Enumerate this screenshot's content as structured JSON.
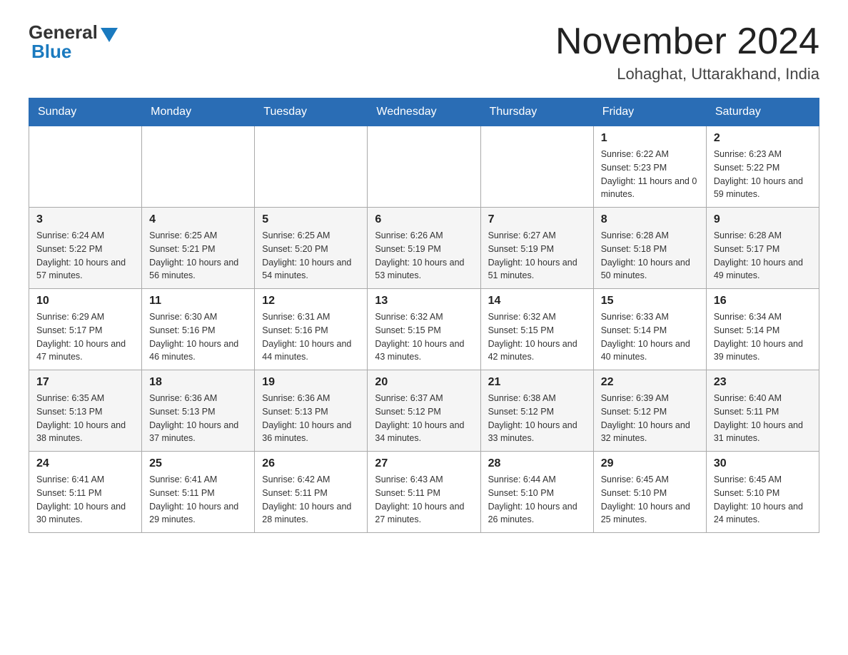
{
  "header": {
    "logo_general": "General",
    "logo_blue": "Blue",
    "month_title": "November 2024",
    "location": "Lohaghat, Uttarakhand, India"
  },
  "days_of_week": [
    "Sunday",
    "Monday",
    "Tuesday",
    "Wednesday",
    "Thursday",
    "Friday",
    "Saturday"
  ],
  "weeks": [
    [
      {
        "day": "",
        "info": ""
      },
      {
        "day": "",
        "info": ""
      },
      {
        "day": "",
        "info": ""
      },
      {
        "day": "",
        "info": ""
      },
      {
        "day": "",
        "info": ""
      },
      {
        "day": "1",
        "info": "Sunrise: 6:22 AM\nSunset: 5:23 PM\nDaylight: 11 hours and 0 minutes."
      },
      {
        "day": "2",
        "info": "Sunrise: 6:23 AM\nSunset: 5:22 PM\nDaylight: 10 hours and 59 minutes."
      }
    ],
    [
      {
        "day": "3",
        "info": "Sunrise: 6:24 AM\nSunset: 5:22 PM\nDaylight: 10 hours and 57 minutes."
      },
      {
        "day": "4",
        "info": "Sunrise: 6:25 AM\nSunset: 5:21 PM\nDaylight: 10 hours and 56 minutes."
      },
      {
        "day": "5",
        "info": "Sunrise: 6:25 AM\nSunset: 5:20 PM\nDaylight: 10 hours and 54 minutes."
      },
      {
        "day": "6",
        "info": "Sunrise: 6:26 AM\nSunset: 5:19 PM\nDaylight: 10 hours and 53 minutes."
      },
      {
        "day": "7",
        "info": "Sunrise: 6:27 AM\nSunset: 5:19 PM\nDaylight: 10 hours and 51 minutes."
      },
      {
        "day": "8",
        "info": "Sunrise: 6:28 AM\nSunset: 5:18 PM\nDaylight: 10 hours and 50 minutes."
      },
      {
        "day": "9",
        "info": "Sunrise: 6:28 AM\nSunset: 5:17 PM\nDaylight: 10 hours and 49 minutes."
      }
    ],
    [
      {
        "day": "10",
        "info": "Sunrise: 6:29 AM\nSunset: 5:17 PM\nDaylight: 10 hours and 47 minutes."
      },
      {
        "day": "11",
        "info": "Sunrise: 6:30 AM\nSunset: 5:16 PM\nDaylight: 10 hours and 46 minutes."
      },
      {
        "day": "12",
        "info": "Sunrise: 6:31 AM\nSunset: 5:16 PM\nDaylight: 10 hours and 44 minutes."
      },
      {
        "day": "13",
        "info": "Sunrise: 6:32 AM\nSunset: 5:15 PM\nDaylight: 10 hours and 43 minutes."
      },
      {
        "day": "14",
        "info": "Sunrise: 6:32 AM\nSunset: 5:15 PM\nDaylight: 10 hours and 42 minutes."
      },
      {
        "day": "15",
        "info": "Sunrise: 6:33 AM\nSunset: 5:14 PM\nDaylight: 10 hours and 40 minutes."
      },
      {
        "day": "16",
        "info": "Sunrise: 6:34 AM\nSunset: 5:14 PM\nDaylight: 10 hours and 39 minutes."
      }
    ],
    [
      {
        "day": "17",
        "info": "Sunrise: 6:35 AM\nSunset: 5:13 PM\nDaylight: 10 hours and 38 minutes."
      },
      {
        "day": "18",
        "info": "Sunrise: 6:36 AM\nSunset: 5:13 PM\nDaylight: 10 hours and 37 minutes."
      },
      {
        "day": "19",
        "info": "Sunrise: 6:36 AM\nSunset: 5:13 PM\nDaylight: 10 hours and 36 minutes."
      },
      {
        "day": "20",
        "info": "Sunrise: 6:37 AM\nSunset: 5:12 PM\nDaylight: 10 hours and 34 minutes."
      },
      {
        "day": "21",
        "info": "Sunrise: 6:38 AM\nSunset: 5:12 PM\nDaylight: 10 hours and 33 minutes."
      },
      {
        "day": "22",
        "info": "Sunrise: 6:39 AM\nSunset: 5:12 PM\nDaylight: 10 hours and 32 minutes."
      },
      {
        "day": "23",
        "info": "Sunrise: 6:40 AM\nSunset: 5:11 PM\nDaylight: 10 hours and 31 minutes."
      }
    ],
    [
      {
        "day": "24",
        "info": "Sunrise: 6:41 AM\nSunset: 5:11 PM\nDaylight: 10 hours and 30 minutes."
      },
      {
        "day": "25",
        "info": "Sunrise: 6:41 AM\nSunset: 5:11 PM\nDaylight: 10 hours and 29 minutes."
      },
      {
        "day": "26",
        "info": "Sunrise: 6:42 AM\nSunset: 5:11 PM\nDaylight: 10 hours and 28 minutes."
      },
      {
        "day": "27",
        "info": "Sunrise: 6:43 AM\nSunset: 5:11 PM\nDaylight: 10 hours and 27 minutes."
      },
      {
        "day": "28",
        "info": "Sunrise: 6:44 AM\nSunset: 5:10 PM\nDaylight: 10 hours and 26 minutes."
      },
      {
        "day": "29",
        "info": "Sunrise: 6:45 AM\nSunset: 5:10 PM\nDaylight: 10 hours and 25 minutes."
      },
      {
        "day": "30",
        "info": "Sunrise: 6:45 AM\nSunset: 5:10 PM\nDaylight: 10 hours and 24 minutes."
      }
    ]
  ]
}
